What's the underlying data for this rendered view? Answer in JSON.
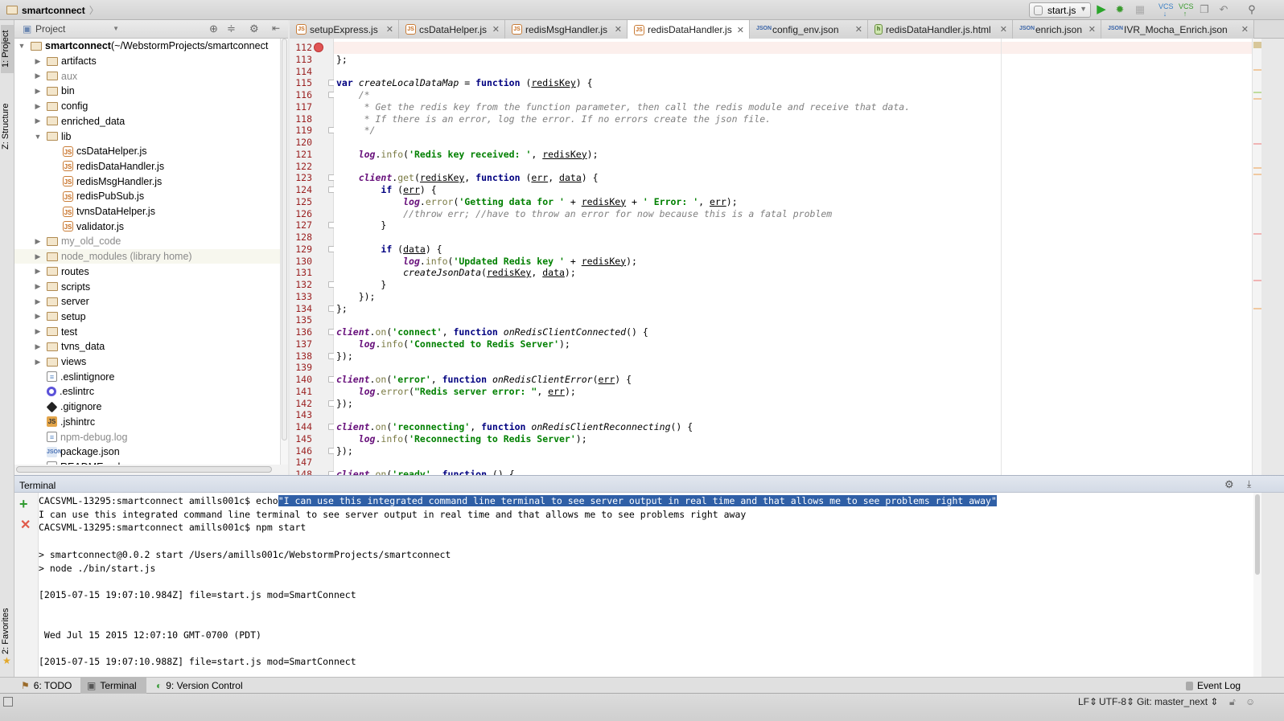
{
  "titlebar": {
    "breadcrumb": "smartconnect",
    "run_config": "start.js",
    "icons": [
      "run-icon",
      "debug-icon",
      "coverage-icon",
      "vcs-update-icon",
      "vcs-commit-icon",
      "compare-icon",
      "revert-icon",
      "search-icon"
    ]
  },
  "tool_strip": {
    "project": "1: Project",
    "structure": "Z: Structure",
    "favorites": "2: Favorites"
  },
  "project": {
    "selector": "Project",
    "root": {
      "name": "smartconnect",
      "path": "(~/WebstormProjects/smartconnect"
    },
    "items": [
      {
        "name": "artifacts",
        "type": "folder",
        "level": 1,
        "expanded": false
      },
      {
        "name": "aux",
        "type": "folder",
        "level": 1,
        "expanded": false,
        "muted": true
      },
      {
        "name": "bin",
        "type": "folder",
        "level": 1,
        "expanded": false
      },
      {
        "name": "config",
        "type": "folder",
        "level": 1,
        "expanded": false
      },
      {
        "name": "enriched_data",
        "type": "folder",
        "level": 1,
        "expanded": false
      },
      {
        "name": "lib",
        "type": "folder",
        "level": 1,
        "expanded": true
      },
      {
        "name": "csDataHelper.js",
        "type": "js",
        "level": 2
      },
      {
        "name": "redisDataHandler.js",
        "type": "js",
        "level": 2
      },
      {
        "name": "redisMsgHandler.js",
        "type": "js",
        "level": 2
      },
      {
        "name": "redisPubSub.js",
        "type": "js",
        "level": 2
      },
      {
        "name": "tvnsDataHelper.js",
        "type": "js",
        "level": 2
      },
      {
        "name": "validator.js",
        "type": "js",
        "level": 2
      },
      {
        "name": "my_old_code",
        "type": "folder",
        "level": 1,
        "expanded": false,
        "muted": true
      },
      {
        "name": "node_modules (library home)",
        "type": "folder",
        "level": 1,
        "expanded": false,
        "muted": true,
        "highlight": true
      },
      {
        "name": "routes",
        "type": "folder",
        "level": 1,
        "expanded": false
      },
      {
        "name": "scripts",
        "type": "folder",
        "level": 1,
        "expanded": false
      },
      {
        "name": "server",
        "type": "folder",
        "level": 1,
        "expanded": false
      },
      {
        "name": "setup",
        "type": "folder",
        "level": 1,
        "expanded": false
      },
      {
        "name": "test",
        "type": "folder",
        "level": 1,
        "expanded": false
      },
      {
        "name": "tvns_data",
        "type": "folder",
        "level": 1,
        "expanded": false
      },
      {
        "name": "views",
        "type": "folder",
        "level": 1,
        "expanded": false
      },
      {
        "name": ".eslintignore",
        "type": "txt",
        "level": 1
      },
      {
        "name": ".eslintrc",
        "type": "eslint",
        "level": 1
      },
      {
        "name": ".gitignore",
        "type": "git",
        "level": 1
      },
      {
        "name": ".jshintrc",
        "type": "jsbig",
        "level": 1
      },
      {
        "name": "npm-debug.log",
        "type": "txt",
        "level": 1,
        "muted": true
      },
      {
        "name": "package.json",
        "type": "json",
        "level": 1
      },
      {
        "name": "README.md",
        "type": "txt",
        "level": 1
      }
    ]
  },
  "tabs": [
    {
      "label": "setupExpress.js",
      "icon": "js"
    },
    {
      "label": "csDataHelper.js",
      "icon": "js"
    },
    {
      "label": "redisMsgHandler.js",
      "icon": "js"
    },
    {
      "label": "redisDataHandler.js",
      "icon": "js",
      "active": true
    },
    {
      "label": "config_env.json",
      "icon": "json"
    },
    {
      "label": "redisDataHandler.js.html",
      "icon": "html"
    },
    {
      "label": "enrich.json",
      "icon": "json"
    },
    {
      "label": "IVR_Mocha_Enrich.json",
      "icon": "json"
    }
  ],
  "editor": {
    "first_line": 112,
    "breakpoint_line": 112,
    "folds": [
      115,
      116,
      119,
      123,
      124,
      127,
      129,
      132,
      134,
      136,
      138,
      140,
      142,
      144,
      146,
      148
    ],
    "lines": [
      [],
      [
        [
          "",
          "};"
        ]
      ],
      [],
      [
        [
          "k",
          "var"
        ],
        [
          "",
          " "
        ],
        [
          "f",
          "createLocalDataMap"
        ],
        [
          "",
          " = "
        ],
        [
          "k",
          "function"
        ],
        [
          "",
          " ("
        ],
        [
          "p",
          "redisKey"
        ],
        [
          "",
          ") {"
        ]
      ],
      [
        [
          "",
          "    "
        ],
        [
          "c",
          "/*"
        ]
      ],
      [
        [
          "",
          "     "
        ],
        [
          "c",
          "* Get the redis key from the function parameter, then call the redis module and receive that data."
        ]
      ],
      [
        [
          "",
          "     "
        ],
        [
          "c",
          "* If there is an error, log the error. If no errors create the json file."
        ]
      ],
      [
        [
          "",
          "     "
        ],
        [
          "c",
          "*/"
        ]
      ],
      [],
      [
        [
          "",
          "    "
        ],
        [
          "g",
          "log"
        ],
        [
          "",
          "."
        ],
        [
          "m",
          "info"
        ],
        [
          "",
          "("
        ],
        [
          "s",
          "'Redis key received: '"
        ],
        [
          "",
          ", "
        ],
        [
          "p",
          "redisKey"
        ],
        [
          "",
          ");"
        ]
      ],
      [],
      [
        [
          "",
          "    "
        ],
        [
          "g",
          "client"
        ],
        [
          "",
          "."
        ],
        [
          "m",
          "get"
        ],
        [
          "",
          "("
        ],
        [
          "p",
          "redisKey"
        ],
        [
          "",
          ", "
        ],
        [
          "k",
          "function"
        ],
        [
          "",
          " ("
        ],
        [
          "p",
          "err"
        ],
        [
          "",
          ", "
        ],
        [
          "p",
          "data"
        ],
        [
          "",
          ") {"
        ]
      ],
      [
        [
          "",
          "        "
        ],
        [
          "k",
          "if"
        ],
        [
          "",
          " ("
        ],
        [
          "p",
          "err"
        ],
        [
          "",
          ") {"
        ]
      ],
      [
        [
          "",
          "            "
        ],
        [
          "g",
          "log"
        ],
        [
          "",
          "."
        ],
        [
          "m",
          "error"
        ],
        [
          "",
          "("
        ],
        [
          "s",
          "'Getting data for '"
        ],
        [
          "",
          " + "
        ],
        [
          "p",
          "redisKey"
        ],
        [
          "",
          " + "
        ],
        [
          "s",
          "' Error: '"
        ],
        [
          "",
          ", "
        ],
        [
          "p",
          "err"
        ],
        [
          "",
          ");"
        ]
      ],
      [
        [
          "",
          "            "
        ],
        [
          "c",
          "//throw err; //have to throw an error for now because this is a fatal problem"
        ]
      ],
      [
        [
          "",
          "        }"
        ]
      ],
      [],
      [
        [
          "",
          "        "
        ],
        [
          "k",
          "if"
        ],
        [
          "",
          " ("
        ],
        [
          "p",
          "data"
        ],
        [
          "",
          ") {"
        ]
      ],
      [
        [
          "",
          "            "
        ],
        [
          "g",
          "log"
        ],
        [
          "",
          "."
        ],
        [
          "m",
          "info"
        ],
        [
          "",
          "("
        ],
        [
          "s",
          "'Updated Redis key '"
        ],
        [
          "",
          " + "
        ],
        [
          "p",
          "redisKey"
        ],
        [
          "",
          ");"
        ]
      ],
      [
        [
          "",
          "            "
        ],
        [
          "f",
          "createJsonData"
        ],
        [
          "",
          "("
        ],
        [
          "p",
          "redisKey"
        ],
        [
          "",
          ", "
        ],
        [
          "p",
          "data"
        ],
        [
          "",
          ");"
        ]
      ],
      [
        [
          "",
          "        }"
        ]
      ],
      [
        [
          "",
          "    });"
        ]
      ],
      [
        [
          "",
          "};"
        ]
      ],
      [],
      [
        [
          "g",
          "client"
        ],
        [
          "",
          "."
        ],
        [
          "m",
          "on"
        ],
        [
          "",
          "("
        ],
        [
          "s",
          "'connect'"
        ],
        [
          "",
          ", "
        ],
        [
          "k",
          "function"
        ],
        [
          "",
          " "
        ],
        [
          "f",
          "onRedisClientConnected"
        ],
        [
          "",
          "() {"
        ]
      ],
      [
        [
          "",
          "    "
        ],
        [
          "g",
          "log"
        ],
        [
          "",
          "."
        ],
        [
          "m",
          "info"
        ],
        [
          "",
          "("
        ],
        [
          "s",
          "'Connected to Redis Server'"
        ],
        [
          "",
          ");"
        ]
      ],
      [
        [
          "",
          "});"
        ]
      ],
      [],
      [
        [
          "g",
          "client"
        ],
        [
          "",
          "."
        ],
        [
          "m",
          "on"
        ],
        [
          "",
          "("
        ],
        [
          "s",
          "'error'"
        ],
        [
          "",
          ", "
        ],
        [
          "k",
          "function"
        ],
        [
          "",
          " "
        ],
        [
          "f",
          "onRedisClientError"
        ],
        [
          "",
          "("
        ],
        [
          "p",
          "err"
        ],
        [
          "",
          ") {"
        ]
      ],
      [
        [
          "",
          "    "
        ],
        [
          "g",
          "log"
        ],
        [
          "",
          "."
        ],
        [
          "m",
          "error"
        ],
        [
          "",
          "("
        ],
        [
          "s",
          "\"Redis server error: \""
        ],
        [
          "",
          ", "
        ],
        [
          "p",
          "err"
        ],
        [
          "",
          ");"
        ]
      ],
      [
        [
          "",
          "});"
        ]
      ],
      [],
      [
        [
          "g",
          "client"
        ],
        [
          "",
          "."
        ],
        [
          "m",
          "on"
        ],
        [
          "",
          "("
        ],
        [
          "s",
          "'reconnecting'"
        ],
        [
          "",
          ", "
        ],
        [
          "k",
          "function"
        ],
        [
          "",
          " "
        ],
        [
          "f",
          "onRedisClientReconnecting"
        ],
        [
          "",
          "() {"
        ]
      ],
      [
        [
          "",
          "    "
        ],
        [
          "g",
          "log"
        ],
        [
          "",
          "."
        ],
        [
          "m",
          "info"
        ],
        [
          "",
          "("
        ],
        [
          "s",
          "'Reconnecting to Redis Server'"
        ],
        [
          "",
          ");"
        ]
      ],
      [
        [
          "",
          "});"
        ]
      ],
      [],
      [
        [
          "g",
          "client"
        ],
        [
          "",
          "."
        ],
        [
          "m",
          "on"
        ],
        [
          "",
          "("
        ],
        [
          "s",
          "'ready'"
        ],
        [
          "",
          ", "
        ],
        [
          "k",
          "function"
        ],
        [
          "",
          " () {"
        ]
      ]
    ]
  },
  "terminal": {
    "title": "Terminal",
    "lines": [
      {
        "text": "CACSVML-13295:smartconnect amills001c$ echo",
        "selected": "\"I can use this integrated command line terminal to see server output in real time and that allows me to see problems right away\""
      },
      {
        "text": "I can use this integrated command line terminal to see server output in real time and that allows me to see problems right away"
      },
      {
        "text": "CACSVML-13295:smartconnect amills001c$ npm start"
      },
      {
        "text": ""
      },
      {
        "text": "> smartconnect@0.0.2 start /Users/amills001c/WebstormProjects/smartconnect"
      },
      {
        "text": "> node ./bin/start.js"
      },
      {
        "text": ""
      },
      {
        "text": "[2015-07-15 19:07:10.984Z] file=start.js mod=SmartConnect"
      },
      {
        "text": ""
      },
      {
        "text": ""
      },
      {
        "text": " Wed Jul 15 2015 12:07:10 GMT-0700 (PDT)"
      },
      {
        "text": ""
      },
      {
        "text": "[2015-07-15 19:07:10.988Z] file=start.js mod=SmartConnect"
      }
    ]
  },
  "bottom_tabs": [
    {
      "label": "6: TODO",
      "icon": "todo-icon"
    },
    {
      "label": "Terminal",
      "icon": "terminal-icon",
      "active": true
    },
    {
      "label": "9: Version Control",
      "icon": "version-control-icon"
    }
  ],
  "event_log": "Event Log",
  "status": {
    "line_sep": "LF",
    "encoding": "UTF-8",
    "git_branch": "Git: master_next"
  },
  "colors": {
    "keyword": "#000080",
    "string": "#008000",
    "comment": "#808080",
    "global": "#660e7a",
    "line_number": "#9a1f1f",
    "selection": "#2f5fa6"
  }
}
